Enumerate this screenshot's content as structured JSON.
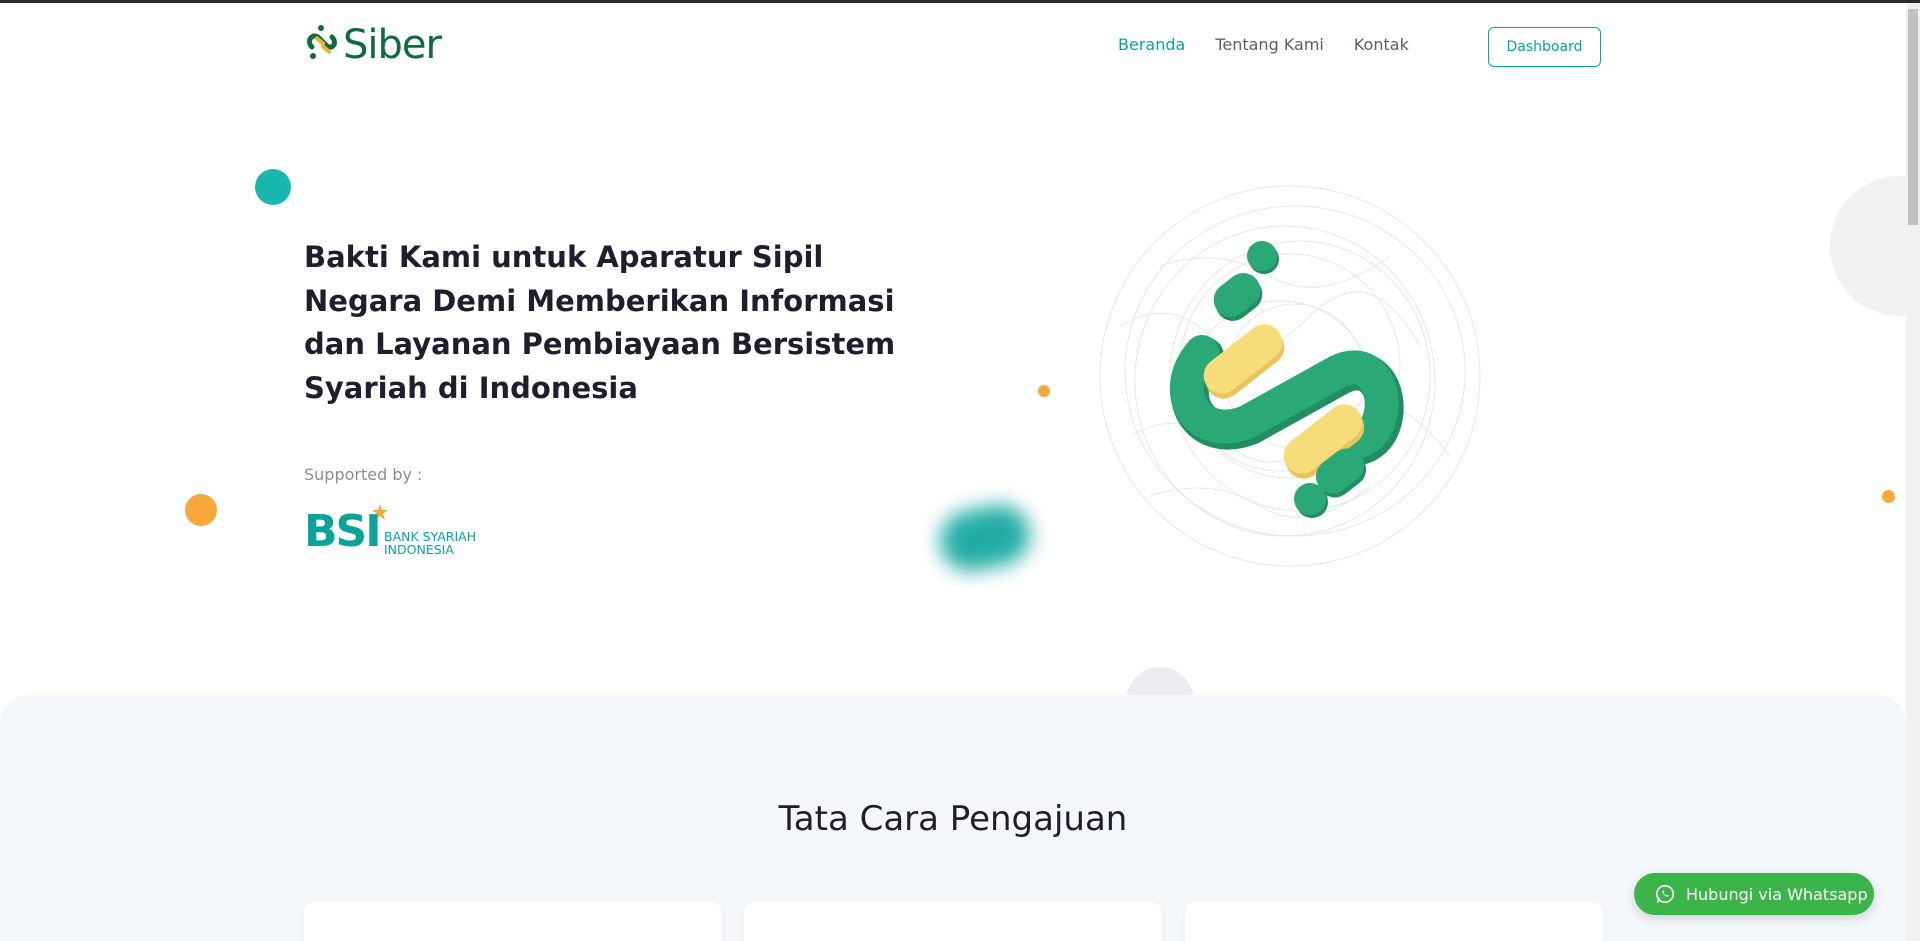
{
  "brand": {
    "name": "Siber"
  },
  "nav": {
    "items": [
      {
        "label": "Beranda",
        "active": true
      },
      {
        "label": "Tentang Kami",
        "active": false
      },
      {
        "label": "Kontak",
        "active": false
      }
    ],
    "dashboard_label": "Dashboard"
  },
  "hero": {
    "title": "Bakti Kami untuk Aparatur Sipil Negara Demi Memberikan Informasi dan Layanan Pembiayaan Bersistem Syariah di Indonesia",
    "supported_by": "Supported by :",
    "partner": {
      "abbr": "BSI",
      "line1": "BANK SYARIAH",
      "line2": "INDONESIA"
    }
  },
  "section": {
    "title": "Tata Cara Pengajuan"
  },
  "whatsapp": {
    "label": "Hubungi via Whatsapp"
  },
  "colors": {
    "accent": "#0aa39a",
    "brand_green": "#0f6b3b",
    "logo_green": "#2aa876",
    "logo_yellow": "#f7dc7a",
    "orange": "#f8a93b",
    "whatsapp": "#3bb54a"
  },
  "icons": [
    "siber-logo-icon",
    "bsi-star-icon",
    "whatsapp-icon"
  ]
}
